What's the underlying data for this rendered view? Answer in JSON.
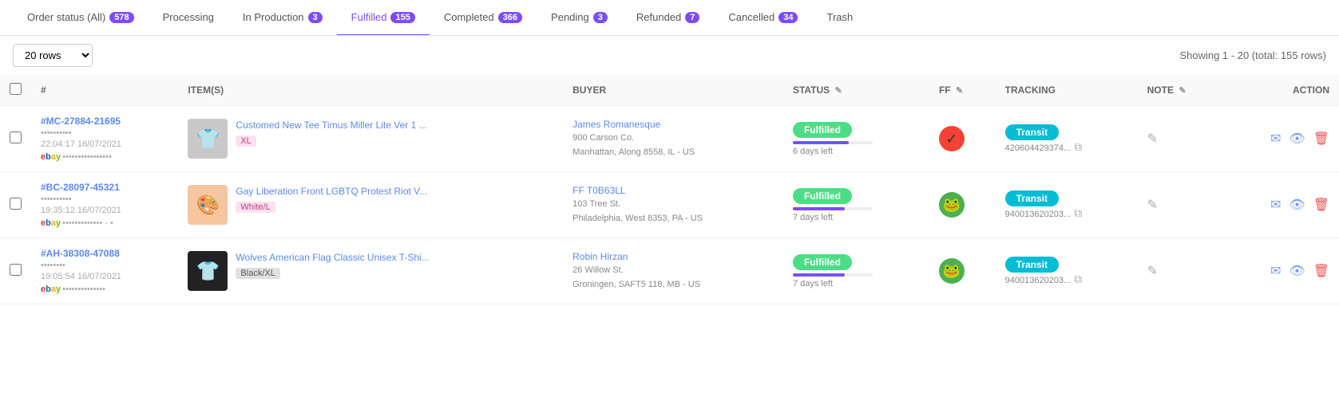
{
  "tabs": [
    {
      "id": "all",
      "label": "Order status (All)",
      "badge": "578",
      "active": false
    },
    {
      "id": "processing",
      "label": "Processing",
      "badge": null,
      "active": false
    },
    {
      "id": "in_production",
      "label": "In Production",
      "badge": "3",
      "active": false
    },
    {
      "id": "fulfilled",
      "label": "Fulfilled",
      "badge": "155",
      "active": true
    },
    {
      "id": "completed",
      "label": "Completed",
      "badge": "366",
      "active": false
    },
    {
      "id": "pending",
      "label": "Pending",
      "badge": "3",
      "active": false
    },
    {
      "id": "refunded",
      "label": "Refunded",
      "badge": "7",
      "active": false
    },
    {
      "id": "cancelled",
      "label": "Cancelled",
      "badge": "34",
      "active": false
    },
    {
      "id": "trash",
      "label": "Trash",
      "badge": null,
      "active": false
    }
  ],
  "toolbar": {
    "rows_value": "20 rows",
    "showing_text": "Showing 1 - 20 (total: 155 rows)"
  },
  "columns": [
    {
      "id": "hash",
      "label": "#",
      "icon": false
    },
    {
      "id": "items",
      "label": "ITEM(S)",
      "icon": false
    },
    {
      "id": "buyer",
      "label": "BUYER",
      "icon": false
    },
    {
      "id": "status",
      "label": "STATUS",
      "icon": true
    },
    {
      "id": "ff",
      "label": "FF",
      "icon": true
    },
    {
      "id": "tracking",
      "label": "TRACKING",
      "icon": false
    },
    {
      "id": "note",
      "label": "NOTE",
      "icon": true
    },
    {
      "id": "action",
      "label": "ACTION",
      "icon": false
    }
  ],
  "rows": [
    {
      "order_id": "#MC-27884-21695",
      "order_num": "••••••••••",
      "order_date": "22:04:17 16/07/2021",
      "platform": "ebay",
      "platform_order": "••••••••••••••••",
      "item_name": "Customed New Tee Timus Miller Lite Ver 1 ...",
      "item_variant": "XL",
      "item_variant_type": "pink",
      "item_thumb_emoji": "👕",
      "item_thumb_bg": "#c8c8c8",
      "buyer_name": "James Romanesque",
      "buyer_company": "900 Carson Co.",
      "buyer_addr": "Manhattan, Along 8558, IL - US",
      "status_label": "Fulfilled",
      "progress": 70,
      "days_left": "6 days left",
      "ff_type": "red",
      "ff_icon": "✓",
      "tracking_label": "Transit",
      "tracking_num": "420604429374...",
      "note_icon": "✎"
    },
    {
      "order_id": "#BC-28097-45321",
      "order_num": "••••••••••",
      "order_date": "19:35:12 16/07/2021",
      "platform": "ebay",
      "platform_order": "••••••••••••• - •",
      "item_name": "Gay Liberation Front LGBTQ Protest Riot V...",
      "item_variant": "White/L",
      "item_variant_type": "pink",
      "item_thumb_emoji": "🎨",
      "item_thumb_bg": "#f5c6a0",
      "buyer_name": "FF T0B63LL",
      "buyer_company": "103 Tree St.",
      "buyer_addr": "Philadelphia, West 8353, PA - US",
      "status_label": "Fulfilled",
      "progress": 65,
      "days_left": "7 days left",
      "ff_type": "green",
      "ff_icon": "🐸",
      "tracking_label": "Transit",
      "tracking_num": "940013620203...",
      "note_icon": "✎"
    },
    {
      "order_id": "#AH-38308-47088",
      "order_num": "••••••••",
      "order_date": "19:05:54 16/07/2021",
      "platform": "ebay",
      "platform_order": "••••••••••••••",
      "item_name": "Wolves American Flag Classic Unisex T-Shi...",
      "item_variant": "Black/XL",
      "item_variant_type": "black",
      "item_thumb_emoji": "👕",
      "item_thumb_bg": "#222",
      "buyer_name": "Robin Hirzan",
      "buyer_company": "26 Willow St.",
      "buyer_addr": "Groningen, SAFT5 118, MB - US",
      "status_label": "Fulfilled",
      "progress": 65,
      "days_left": "7 days left",
      "ff_type": "green",
      "ff_icon": "🐸",
      "tracking_label": "Transit",
      "tracking_num": "940013620203...",
      "note_icon": "✎"
    }
  ]
}
